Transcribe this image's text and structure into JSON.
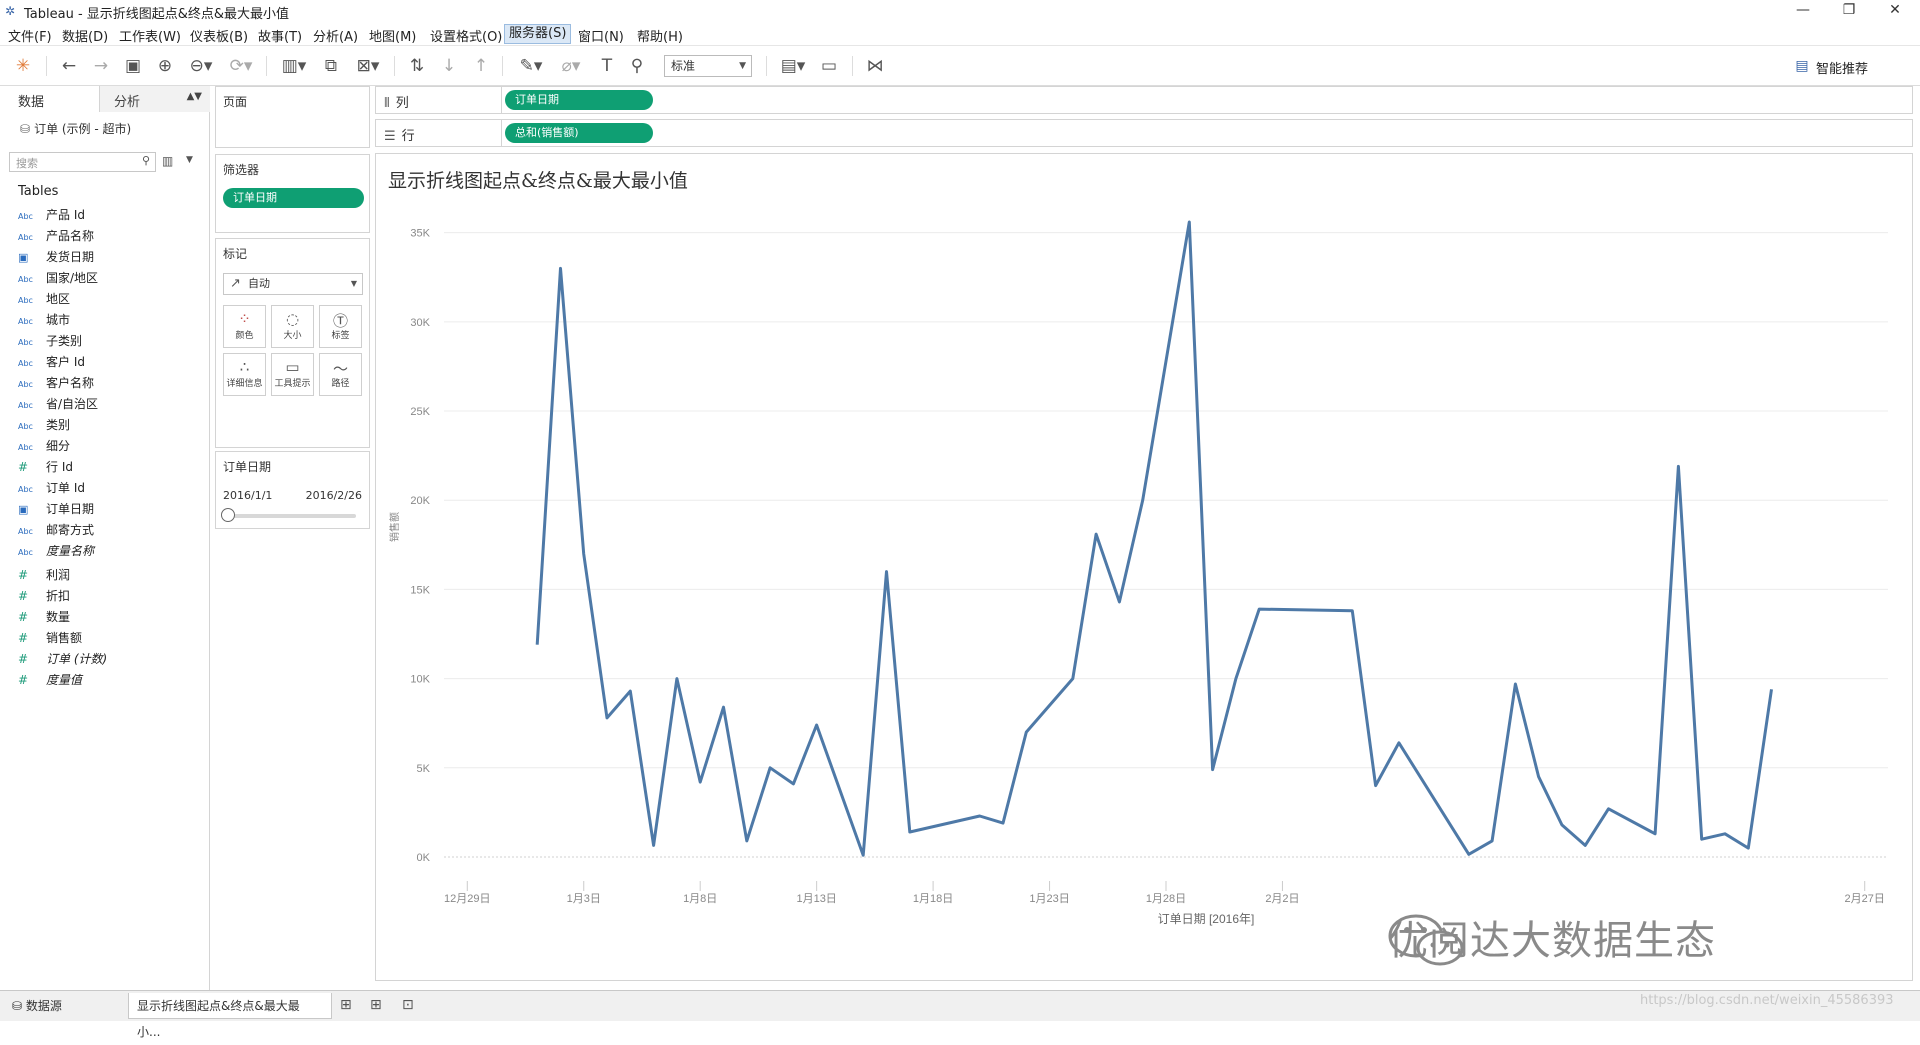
{
  "window": {
    "title": "Tableau - 显示折线图起点&终点&最大最小值"
  },
  "menu": [
    "文件(F)",
    "数据(D)",
    "工作表(W)",
    "仪表板(B)",
    "故事(T)",
    "分析(A)",
    "地图(M)",
    "设置格式(O)",
    "服务器(S)",
    "窗口(N)",
    "帮助(H)"
  ],
  "toolbar": {
    "fit_select": "标准",
    "smart": "智能推荐"
  },
  "left": {
    "tab_data": "数据",
    "tab_analysis": "分析",
    "datasource": "订单 (示例 - 超市)",
    "search_placeholder": "搜索",
    "tables_label": "Tables",
    "fields": [
      {
        "type": "Abc",
        "name": "产品 Id"
      },
      {
        "type": "Abc",
        "name": "产品名称"
      },
      {
        "type": "cal",
        "name": "发货日期"
      },
      {
        "type": "Abc",
        "name": "国家/地区"
      },
      {
        "type": "Abc",
        "name": "地区"
      },
      {
        "type": "Abc",
        "name": "城市"
      },
      {
        "type": "Abc",
        "name": "子类别"
      },
      {
        "type": "Abc",
        "name": "客户 Id"
      },
      {
        "type": "Abc",
        "name": "客户名称"
      },
      {
        "type": "Abc",
        "name": "省/自治区"
      },
      {
        "type": "Abc",
        "name": "类别"
      },
      {
        "type": "Abc",
        "name": "细分"
      },
      {
        "type": "#",
        "name": "行 Id"
      },
      {
        "type": "Abc",
        "name": "订单 Id"
      },
      {
        "type": "cal",
        "name": "订单日期"
      },
      {
        "type": "Abc",
        "name": "邮寄方式"
      },
      {
        "type": "Abc",
        "name": "度量名称",
        "italic": true
      }
    ],
    "measures": [
      {
        "type": "#",
        "name": "利润"
      },
      {
        "type": "#",
        "name": "折扣"
      },
      {
        "type": "#",
        "name": "数量"
      },
      {
        "type": "#",
        "name": "销售额"
      },
      {
        "type": "#",
        "name": "订单 (计数)",
        "italic": true
      },
      {
        "type": "#",
        "name": "度量值",
        "italic": true
      }
    ]
  },
  "cards": {
    "pages": "页面",
    "filters": "筛选器",
    "filter_pill": "订单日期",
    "marks": "标记",
    "mark_type": "自动",
    "mark_buttons": [
      "颜色",
      "大小",
      "标签",
      "详细信息",
      "工具提示",
      "路径"
    ],
    "date_filter_title": "订单日期",
    "date_from": "2016/1/1",
    "date_to": "2016/2/26"
  },
  "shelves": {
    "columns_label": "列",
    "columns_pill": "订单日期",
    "rows_label": "行",
    "rows_pill": "总和(销售额)"
  },
  "viz": {
    "title": "显示折线图起点&终点&最大最小值"
  },
  "chart_data": {
    "type": "line",
    "title": "显示折线图起点&终点&最大最小值",
    "xlabel": "订单日期 [2016年]",
    "ylabel": "销售额",
    "x_ticks": [
      "12月29日",
      "1月3日",
      "1月8日",
      "1月13日",
      "1月18日",
      "1月23日",
      "1月28日",
      "2月2日",
      "2月27日"
    ],
    "y_ticks": [
      "0K",
      "5K",
      "10K",
      "15K",
      "20K",
      "25K",
      "30K",
      "35K"
    ],
    "ylim": [
      0,
      37000
    ],
    "xlim": [
      "2015-12-28",
      "2016-02-28"
    ],
    "series": [
      {
        "x": [
          "2016-01-01",
          "2016-01-02",
          "2016-01-03",
          "2016-01-04",
          "2016-01-05",
          "2016-01-06",
          "2016-01-07",
          "2016-01-08",
          "2016-01-09",
          "2016-01-10",
          "2016-01-11",
          "2016-01-12",
          "2016-01-13",
          "2016-01-15",
          "2016-01-16",
          "2016-01-17",
          "2016-01-20",
          "2016-01-21",
          "2016-01-22",
          "2016-01-24",
          "2016-01-25",
          "2016-01-26",
          "2016-01-27",
          "2016-01-29",
          "2016-01-30",
          "2016-01-31",
          "2016-02-01",
          "2016-02-05",
          "2016-02-06",
          "2016-02-07",
          "2016-02-10",
          "2016-02-11",
          "2016-02-12",
          "2016-02-13",
          "2016-02-14",
          "2016-02-15",
          "2016-02-16",
          "2016-02-18",
          "2016-02-19",
          "2016-02-20",
          "2016-02-21",
          "2016-02-22",
          "2016-02-23"
        ],
        "values": [
          11900,
          33000,
          17000,
          7800,
          9300,
          650,
          10000,
          4200,
          8400,
          900,
          5000,
          4100,
          7400,
          100,
          16000,
          1400,
          2300,
          1900,
          7000,
          10000,
          18100,
          14300,
          20000,
          35600,
          4900,
          10000,
          13900,
          13800,
          4000,
          6400,
          150,
          900,
          9700,
          4500,
          1800,
          650,
          2700,
          1300,
          21900,
          1000,
          1300,
          500,
          9400
        ]
      }
    ],
    "color": "#4e79a7",
    "grid": true
  },
  "bottom": {
    "datasource_tab": "数据源",
    "sheet_tab": "显示折线图起点&终点&最大最小...",
    "watermark": "优阅达大数据生态",
    "url": "https://blog.csdn.net/weixin_45586393"
  }
}
